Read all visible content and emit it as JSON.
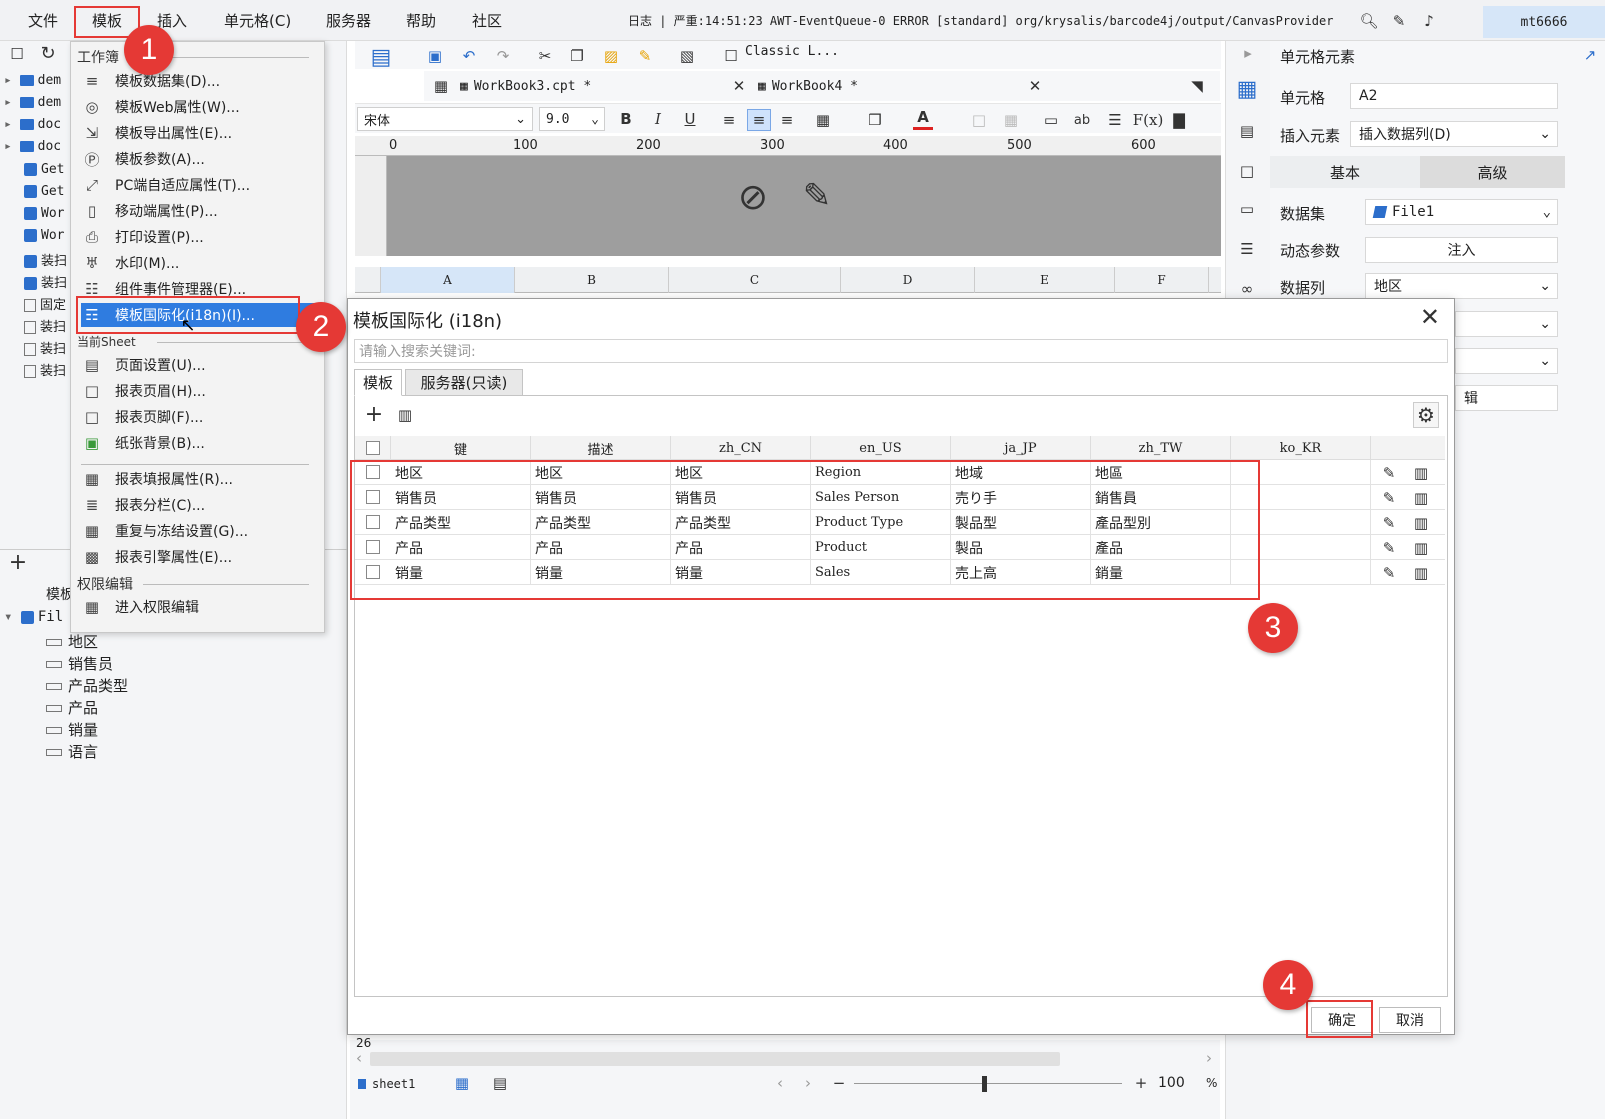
{
  "menubar": {
    "items": [
      "文件",
      "模板",
      "插入",
      "单元格(C)",
      "服务器",
      "帮助",
      "社区"
    ],
    "status": "日志 | 严重:14:51:23 AWT-EventQueue-0 ERROR [standard] org/krysalis/barcode4j/output/CanvasProvider",
    "user": "mt6666"
  },
  "left_tree": {
    "items": [
      "dem",
      "dem",
      "doc",
      "doc",
      "Get",
      "Get",
      "Wor",
      "Wor",
      "装扫",
      "装扫",
      "固定",
      "装扫",
      "装扫",
      "装扫"
    ],
    "dataset_label": "模板",
    "dataset_name": "Fil",
    "fields": [
      "地区",
      "销售员",
      "产品类型",
      "产品",
      "销量",
      "语言"
    ]
  },
  "template_menu": {
    "section_workbook": "工作簿",
    "section_sheet": "当前Sheet",
    "section_permission": "权限编辑",
    "items": [
      "模板数据集(D)...",
      "模板Web属性(W)...",
      "模板导出属性(E)...",
      "模板参数(A)...",
      "PC端自适应属性(T)...",
      "移动端属性(P)...",
      "打印设置(P)...",
      "水印(M)...",
      "组件事件管理器(E)...",
      "模板国际化(i18n)(I)...",
      "页面设置(U)...",
      "报表页眉(H)...",
      "报表页脚(F)...",
      "纸张背景(B)...",
      "报表填报属性(R)...",
      "报表分栏(C)...",
      "重复与冻结设置(G)...",
      "报表引擎属性(E)...",
      "进入权限编辑"
    ]
  },
  "editor": {
    "theme": "Classic L...",
    "tabs": [
      "WorkBook3.cpt *",
      "WorkBook4 *"
    ],
    "font": "宋体",
    "font_size": "9.0",
    "ruler_marks": [
      "0",
      "100",
      "200",
      "300",
      "400",
      "500",
      "600"
    ],
    "columns": [
      "A",
      "B",
      "C",
      "D",
      "E",
      "F"
    ],
    "row_num": "26",
    "sheet_tab": "sheet1",
    "zoom": "100",
    "zoom_unit": "%"
  },
  "right_panel": {
    "title": "单元格元素",
    "cell_label": "单元格",
    "cell_value": "A2",
    "insert_label": "插入元素",
    "insert_value": "插入数据列(D)",
    "tab_basic": "基本",
    "tab_advanced": "高级",
    "dataset_label": "数据集",
    "dataset_value": "File1",
    "param_label": "动态参数",
    "param_value": "注入",
    "column_label": "数据列",
    "column_value": "地区",
    "edit_fragment": "辑"
  },
  "dialog": {
    "title": "模板国际化 (i18n)",
    "search_placeholder": "请输入搜索关键词:",
    "tabs": [
      "模板",
      "服务器(只读)"
    ],
    "headers": [
      "键",
      "描述",
      "zh_CN",
      "en_US",
      "ja_JP",
      "zh_TW",
      "ko_KR"
    ],
    "rows": [
      {
        "key": "地区",
        "desc": "地区",
        "zh_CN": "地区",
        "en_US": "Region",
        "ja_JP": "地域",
        "zh_TW": "地區",
        "ko_KR": ""
      },
      {
        "key": "销售员",
        "desc": "销售员",
        "zh_CN": "销售员",
        "en_US": "Sales Person",
        "ja_JP": "売り手",
        "zh_TW": "銷售員",
        "ko_KR": ""
      },
      {
        "key": "产品类型",
        "desc": "产品类型",
        "zh_CN": "产品类型",
        "en_US": "Product Type",
        "ja_JP": "製品型",
        "zh_TW": "產品型別",
        "ko_KR": ""
      },
      {
        "key": "产品",
        "desc": "产品",
        "zh_CN": "产品",
        "en_US": "Product",
        "ja_JP": "製品",
        "zh_TW": "產品",
        "ko_KR": ""
      },
      {
        "key": "销量",
        "desc": "销量",
        "zh_CN": "销量",
        "en_US": "Sales",
        "ja_JP": "売上高",
        "zh_TW": "銷量",
        "ko_KR": ""
      }
    ],
    "ok": "确定",
    "cancel": "取消"
  },
  "annotations": [
    "1",
    "2",
    "3",
    "4"
  ],
  "colors": {
    "annotation_red": "#e53935",
    "selection_blue": "#2f7ce0",
    "accent": "#2c6ecb"
  }
}
